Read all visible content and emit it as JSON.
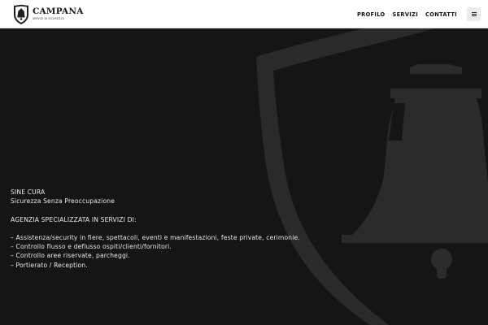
{
  "brand": {
    "name": "CAMPANA",
    "tagline": "SERVIZI DI SICUREZZA"
  },
  "nav": {
    "items": [
      {
        "label": "PROFILO"
      },
      {
        "label": "SERVIZI"
      },
      {
        "label": "CONTATTI"
      }
    ],
    "menu_icon": "hamburger-icon"
  },
  "hero": {
    "title": "SINE CURA",
    "subtitle": "Sicurezza Senza Preoccupazione",
    "heading": "AGENZIA SPECIALIZZATA IN SERVIZI DI:",
    "services": [
      "– Assistenza/security in fiere, spettacoli, eventi e manifestazioni, feste private, cerimonie.",
      "– Controllo flusso e deflusso ospiti/clienti/fornitori.",
      "– Controllo aree riservate, parcheggi.",
      "– Portierato / Reception."
    ],
    "background_icon": "shield-bell-icon"
  },
  "colors": {
    "header_bg": "#ffffff",
    "hero_bg": "#151515",
    "emblem": "#2b2b2b",
    "hero_text": "#e9e9e9"
  }
}
